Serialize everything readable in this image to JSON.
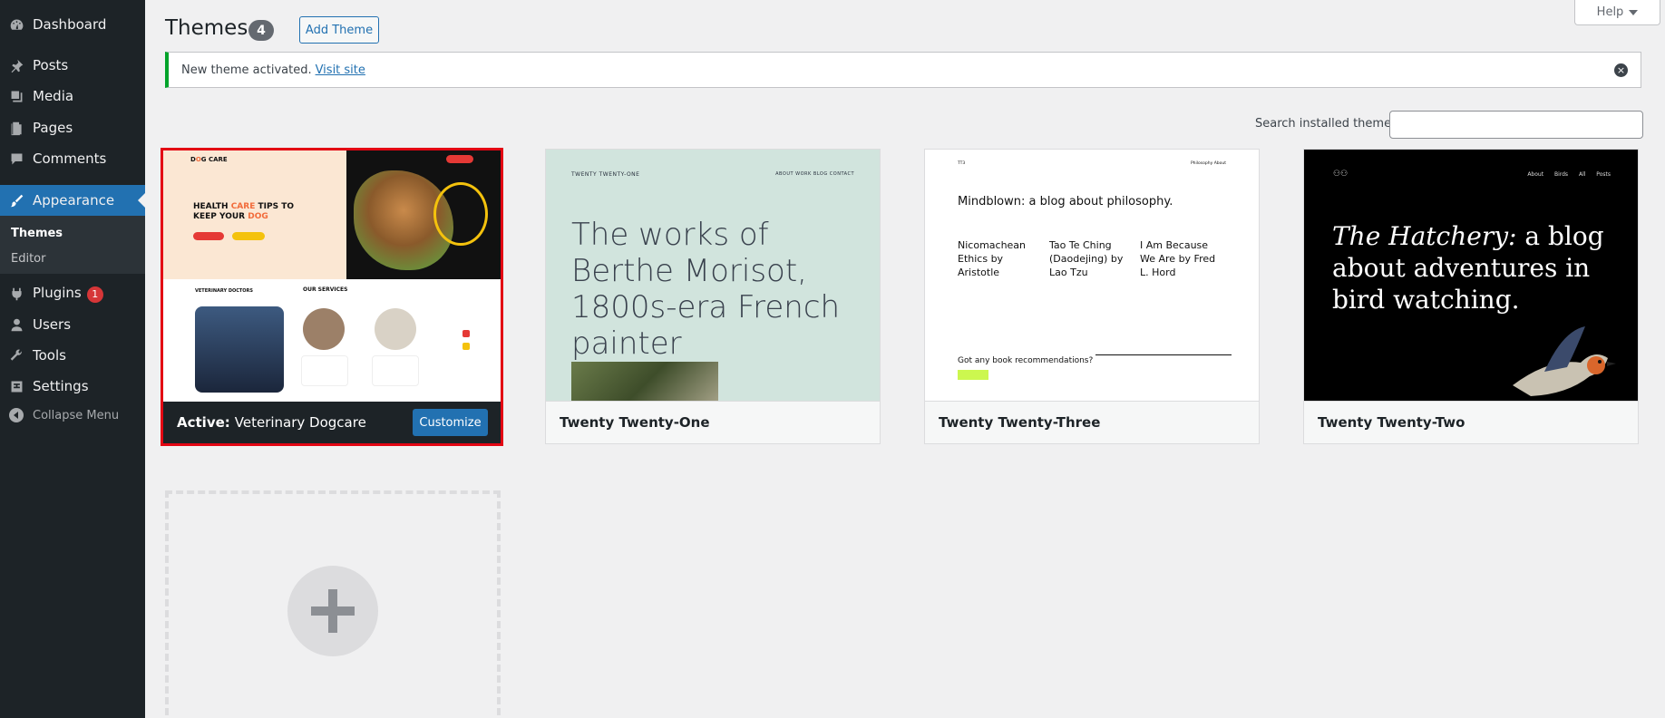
{
  "sidebar": {
    "items": [
      {
        "label": "Dashboard",
        "icon": "dashboard-icon"
      },
      {
        "label": "Posts",
        "icon": "pin-icon"
      },
      {
        "label": "Media",
        "icon": "media-icon"
      },
      {
        "label": "Pages",
        "icon": "pages-icon"
      },
      {
        "label": "Comments",
        "icon": "comments-icon"
      },
      {
        "label": "Appearance",
        "icon": "paintbrush-icon"
      },
      {
        "label": "Plugins",
        "icon": "plugins-icon",
        "badge": "1"
      },
      {
        "label": "Users",
        "icon": "users-icon"
      },
      {
        "label": "Tools",
        "icon": "wrench-icon"
      },
      {
        "label": "Settings",
        "icon": "settings-icon"
      }
    ],
    "submenu": {
      "themes": "Themes",
      "editor": "Editor"
    },
    "collapse_label": "Collapse Menu"
  },
  "header": {
    "title": "Themes",
    "count": "4",
    "add_button": "Add Theme",
    "help": "Help"
  },
  "notice": {
    "text": "New theme activated.",
    "link": "Visit site"
  },
  "search": {
    "label": "Search installed themes",
    "value": ""
  },
  "themes": {
    "active": {
      "prefix": "Active:",
      "name": "Veterinary Dogcare",
      "customize": "Customize",
      "preview": {
        "logo_a": "D",
        "logo_b": "G",
        "logo_c": "CARE",
        "headline_1": "HEALTH ",
        "headline_2": "CARE",
        "headline_3": " TIPS TO KEEP YOUR ",
        "headline_4": "DOG",
        "sec_doctors": "VETERINARY DOCTORS",
        "sec_services": "OUR SERVICES"
      }
    },
    "t21": {
      "name": "Twenty Twenty-One",
      "preview": {
        "site": "TWENTY TWENTY-ONE",
        "nav": "ABOUT   WORK   BLOG   CONTACT",
        "headline": "The works of Berthe Morisot, 1800s-era French painter"
      }
    },
    "t23": {
      "name": "Twenty Twenty-Three",
      "preview": {
        "site": "TT3",
        "nav": "Philosophy   About",
        "title": "Mindblown: a blog about philosophy.",
        "posts": [
          "Nicomachean Ethics by Aristotle",
          "Tao Te Ching (Daodejing) by Lao Tzu",
          "I Am Because We Are by Fred L. Hord"
        ],
        "question": "Got any book recommendations?"
      }
    },
    "t22": {
      "name": "Twenty Twenty-Two",
      "preview": {
        "nav": "About Birds All Posts",
        "headline_italic": "The Hatchery:",
        "headline_rest": " a blog about adventures in bird watching."
      }
    }
  },
  "colors": {
    "sidebar_bg": "#1d2327",
    "accent": "#2271b1",
    "active_border": "#e30613",
    "notice_success": "#00a32a",
    "badge": "#d63638"
  }
}
